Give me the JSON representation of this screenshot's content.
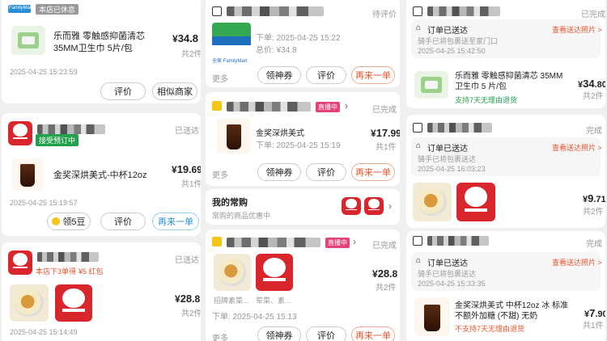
{
  "col1": {
    "card1": {
      "brand": "FamilyMart",
      "status_tag": "本店已休息",
      "product": "乐而雅 零触感抑菌清芯35MM卫生巾 5片/包",
      "price_symbol": "¥",
      "price": "34.8",
      "qty": "共2件",
      "time": "2025-04-25 15:23:59",
      "btn_review": "评价",
      "btn_similar": "相似商家"
    },
    "card2": {
      "status": "已送达",
      "tag": "接受预订中",
      "product": "金奖深烘美式-中杯12oz",
      "price_int": "19",
      "price_dec": ".69",
      "qty": "共1件",
      "time": "2025-04-25 15:19:57",
      "btn_beans": "领5豆",
      "btn_review": "评价",
      "btn_reorder": "再来一单"
    },
    "card3": {
      "status": "已送达",
      "promo": "本店下3单得",
      "promo_coupon": "¥5 红包",
      "price_int": "28",
      "price_dec": ".8",
      "qty": "共2件",
      "time": "2025-04-25 15:14:49"
    }
  },
  "col2": {
    "card1": {
      "status": "待评价",
      "order_time_label": "下单: 2025-04-25 15:22",
      "total_label": "总价: ¥34.8",
      "logo_text": "全家 FamilyMart",
      "more": "更多",
      "btn_coupon": "领神券",
      "btn_review": "评价",
      "btn_reorder": "再来一单"
    },
    "card2": {
      "live_tag": "直播中",
      "status": "已完成",
      "product": "金奖深烘美式",
      "order_time_label": "下单: 2025-04-25 15:19",
      "price_int": "17",
      "price_dec": ".99",
      "qty": "共1件",
      "more": "更多",
      "btn_coupon": "领神券",
      "btn_review": "评价",
      "btn_reorder": "再来一单"
    },
    "frequent": {
      "title": "我的常购",
      "subtitle": "常购的商品优惠中"
    },
    "card3": {
      "live_tag": "直播中",
      "status": "已完成",
      "item1_caption": "招牌素菜...",
      "item2_caption": "荤菜、素...",
      "order_time_label": "下单: 2025-04-25 15:13",
      "price_int": "28",
      "price_dec": ".8",
      "qty": "共2件",
      "more": "更多",
      "btn_coupon": "领神券",
      "btn_review": "评价",
      "btn_reorder": "再来一单"
    }
  },
  "col3": {
    "card1": {
      "status": "已完成",
      "delivered_title": "订单已送达",
      "view_photos": "查看送达照片 >",
      "rider_note": "骑手已将包裹送至家门口",
      "delivered_time": "2025-04-25 15:42:50",
      "product": "乐而雅 零触感抑菌清芯 35MM 卫生巾 5 片/包",
      "return_note": "支持7天无理由退货",
      "price_int": "34",
      "price_dec": ".80",
      "qty": "共2件"
    },
    "card2": {
      "status": "完成",
      "delivered_title": "订单已送达",
      "view_photos": "查看送达照片 >",
      "rider_note": "骑手已将包裹送达",
      "delivered_time": "2025-04-25 16:03:23",
      "price_int": "9",
      "price_dec": ".71",
      "qty": "共2件"
    },
    "card3": {
      "status": "完成",
      "delivered_title": "订单已送达",
      "view_photos": "查看送达照片 >",
      "rider_note": "骑手已将包裹送达",
      "delivered_time": "2025-04-25 15:33:35",
      "product": "金奖深烘美式 中杯12oz 冰 标准 不额外加糖 (不甜) 无奶",
      "return_note": "不支持7天无理由退货",
      "price_int": "7",
      "price_dec": ".90",
      "qty": "共1件"
    }
  }
}
